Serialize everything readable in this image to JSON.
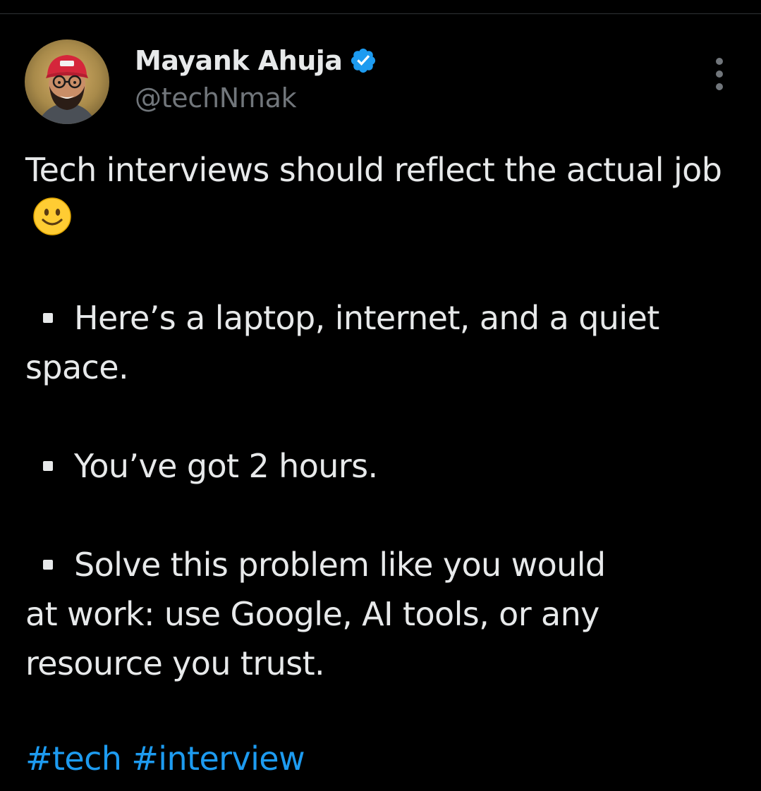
{
  "author": {
    "name": "Mayank Ahuja",
    "handle": "@techNmak",
    "verified_icon": "verified-badge-icon",
    "verified_color": "#1d9bf0"
  },
  "tweet": {
    "intro": "Tech interviews should reflect the actual job",
    "intro_emoji": "slightly-smiling-face-emoji",
    "bullets": [
      {
        "line1": "Here’s a laptop, internet, and a quiet",
        "line2": "space."
      },
      {
        "line1": "You’ve got 2 hours.",
        "line2": ""
      },
      {
        "line1": "Solve this problem like you would",
        "line2": "at work: use Google, AI tools, or any",
        "line3": "resource you trust."
      }
    ],
    "hashtags": [
      "#tech",
      "#interview"
    ],
    "hashtag_color": "#1d9bf0"
  },
  "menu": {
    "icon": "more-vertical-icon"
  }
}
